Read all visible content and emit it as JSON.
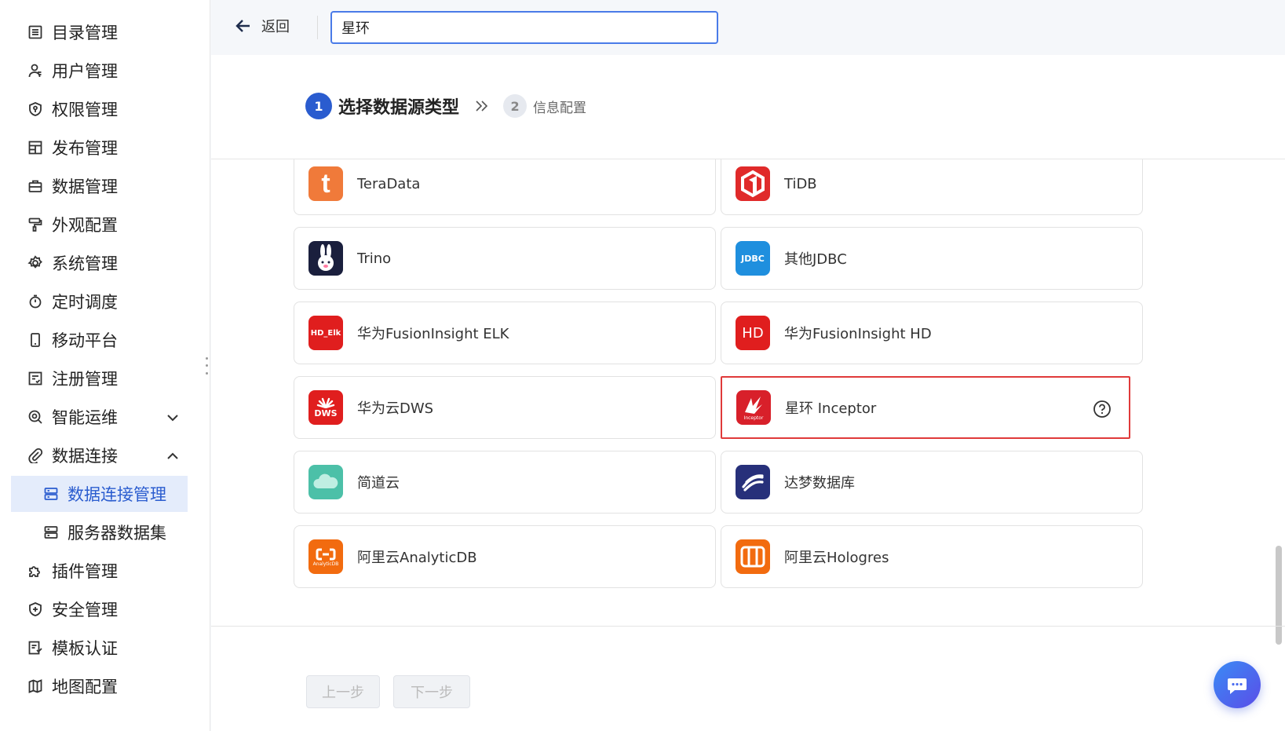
{
  "sidebar": {
    "items": [
      {
        "label": "目录管理",
        "icon": "list-icon"
      },
      {
        "label": "用户管理",
        "icon": "user-icon"
      },
      {
        "label": "权限管理",
        "icon": "shield-key-icon"
      },
      {
        "label": "发布管理",
        "icon": "layout-icon"
      },
      {
        "label": "数据管理",
        "icon": "briefcase-icon"
      },
      {
        "label": "外观配置",
        "icon": "paint-roller-icon"
      },
      {
        "label": "系统管理",
        "icon": "gear-icon"
      },
      {
        "label": "定时调度",
        "icon": "stopwatch-icon"
      },
      {
        "label": "移动平台",
        "icon": "mobile-icon"
      },
      {
        "label": "注册管理",
        "icon": "register-icon"
      },
      {
        "label": "智能运维",
        "icon": "ops-icon"
      },
      {
        "label": "数据连接",
        "icon": "paperclip-icon"
      },
      {
        "label": "数据连接管理",
        "icon": "server-icon"
      },
      {
        "label": "服务器数据集",
        "icon": "server-dataset-icon"
      },
      {
        "label": "插件管理",
        "icon": "puzzle-icon"
      },
      {
        "label": "安全管理",
        "icon": "shield-plus-icon"
      },
      {
        "label": "模板认证",
        "icon": "certificate-icon"
      },
      {
        "label": "地图配置",
        "icon": "map-icon"
      }
    ]
  },
  "topbar": {
    "back_label": "返回",
    "search_value": "星环"
  },
  "steps": {
    "step1_num": "1",
    "step1_label": "选择数据源类型",
    "step2_num": "2",
    "step2_label": "信息配置"
  },
  "datasources": [
    {
      "name": "TeraData",
      "logo_text": "t",
      "color": "#f07a3a"
    },
    {
      "name": "TiDB",
      "logo_text": "",
      "color": "#e02a2a"
    },
    {
      "name": "Trino",
      "logo_text": "",
      "color": "#1a1f3d"
    },
    {
      "name": "其他JDBC",
      "logo_text": "JDBC",
      "color": "#1f8fde"
    },
    {
      "name": "华为FusionInsight ELK",
      "logo_text": "HD_Elk",
      "color": "#e01e1e"
    },
    {
      "name": "华为FusionInsight HD",
      "logo_text": "HD",
      "color": "#e01e1e"
    },
    {
      "name": "华为云DWS",
      "logo_text": "DWS",
      "color": "#e01e1e"
    },
    {
      "name": "星环 Inceptor",
      "logo_text": "Inceptor",
      "color": "#d8202a"
    },
    {
      "name": "简道云",
      "logo_text": "",
      "color": "#4cc0a8"
    },
    {
      "name": "达梦数据库",
      "logo_text": "",
      "color": "#27307a"
    },
    {
      "name": "阿里云AnalyticDB",
      "logo_text": "AnalyticDB",
      "color": "#f26b0f"
    },
    {
      "name": "阿里云Hologres",
      "logo_text": "",
      "color": "#f26b0f"
    }
  ],
  "buttons": {
    "prev_label": "上一步",
    "next_label": "下一步"
  },
  "colors": {
    "accent": "#2a5ccf",
    "selected_border": "#e03a3a",
    "active_nav_bg": "#e4ecfb"
  }
}
